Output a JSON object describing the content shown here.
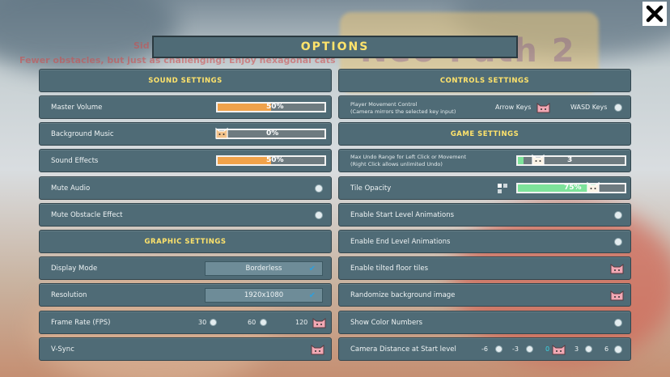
{
  "title": "OPTIONS",
  "close_label": "close",
  "background_text": {
    "line1": "Sid",
    "line2": "Fewer obstacles, but just as challenging! Enjoy hexagonal cats",
    "big": "Neo Path 2"
  },
  "sound": {
    "header": "SOUND SETTINGS",
    "master_volume": {
      "label": "Master Volume",
      "value": 0.5,
      "text": "50%"
    },
    "background_music": {
      "label": "Background Music",
      "value": 0.0,
      "text": "0%"
    },
    "sound_effects": {
      "label": "Sound Effects",
      "value": 0.5,
      "text": "50%"
    },
    "mute_audio": {
      "label": "Mute Audio"
    },
    "mute_obstacle": {
      "label": "Mute Obstacle Effect"
    }
  },
  "graphic": {
    "header": "GRAPHIC SETTINGS",
    "display_mode": {
      "label": "Display Mode",
      "value": "Borderless"
    },
    "resolution": {
      "label": "Resolution",
      "value": "1920x1080"
    },
    "frame_rate": {
      "label": "Frame Rate (FPS)",
      "options": [
        "30",
        "60",
        "120"
      ]
    },
    "vsync": {
      "label": "V-Sync"
    }
  },
  "controls": {
    "header": "CONTROLS SETTINGS",
    "movement_line1": "Player Movement Control",
    "movement_line2": "(Camera mirrors the selected key input)",
    "arrow_keys": "Arrow Keys",
    "wasd_keys": "WASD Keys"
  },
  "game": {
    "header": "GAME SETTINGS",
    "undo_line1": "Max Undo Range for Left Click or Movement",
    "undo_line2": "(Right Click allows unlimited Undo)",
    "undo_value": "3",
    "undo_fraction": 0.05,
    "tile_opacity": {
      "label": "Tile Opacity",
      "value": 0.75,
      "text": "75%"
    },
    "start_anim": "Enable Start Level Animations",
    "end_anim": "Enable End Level Animations",
    "tilted_tiles": "Enable tilted floor tiles",
    "randomize_bg": "Randomize background image",
    "show_color_numbers": "Show Color Numbers",
    "camera_distance": {
      "label": "Camera Distance at Start level",
      "options": [
        "-6",
        "-3",
        "0",
        "3",
        "6"
      ]
    }
  },
  "colors": {
    "accent_yellow": "#ffe36b",
    "row_bg": "#4f6b76",
    "orange_fill": "#f0a24a",
    "green_fill": "#7de39a",
    "teal_selected": "#39d6e6"
  }
}
